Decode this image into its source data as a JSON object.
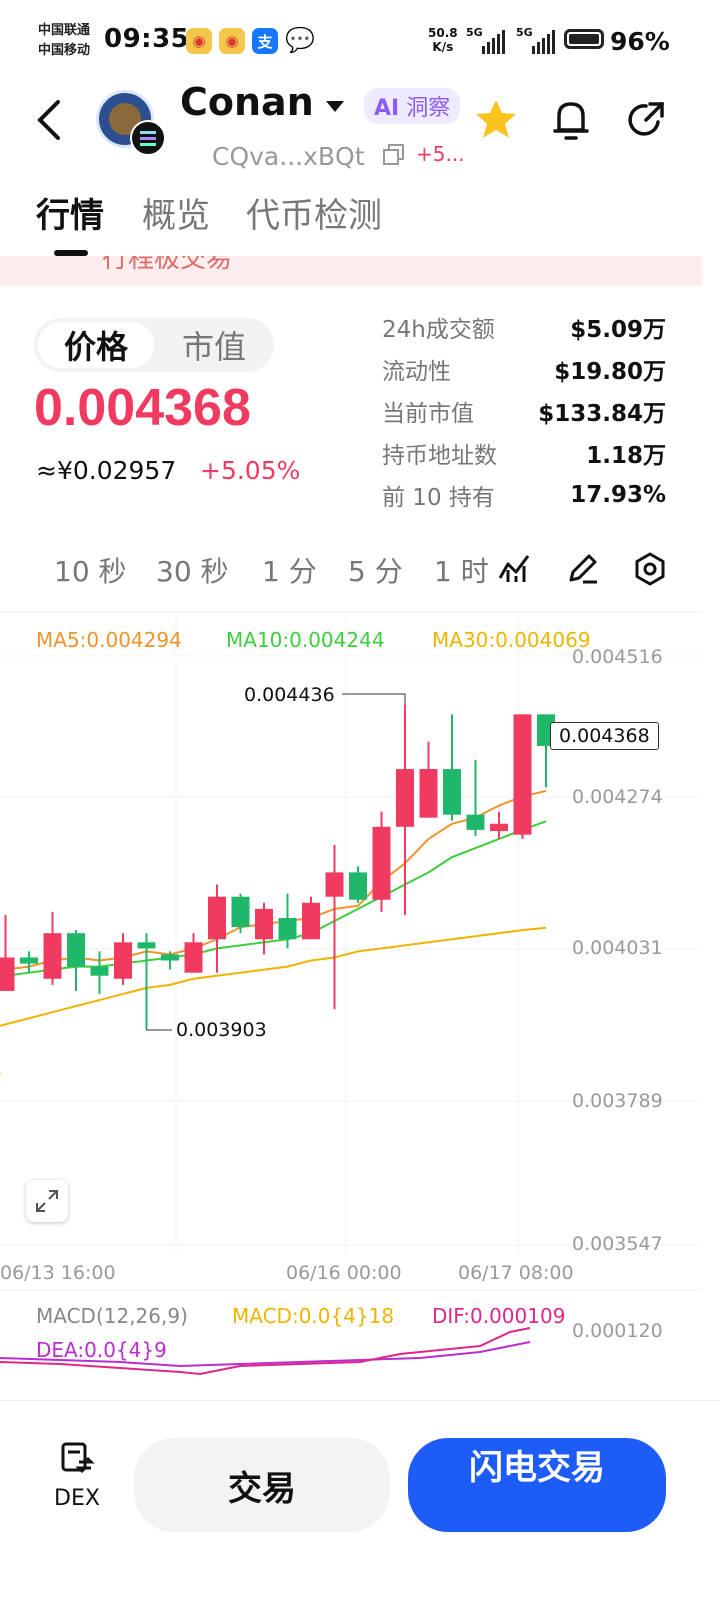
{
  "status_bar": {
    "carrier_1": "中国联通",
    "carrier_2": "中国移动",
    "time": "09:35",
    "net_speed_value": "50.8",
    "net_speed_unit": "K/s",
    "net_type_1": "5G",
    "net_type_2": "5G",
    "battery": "96%",
    "app_icons": [
      "weibo-icon",
      "weibo-icon",
      "alipay-icon",
      "wechat-icon"
    ]
  },
  "header": {
    "title": "Conan",
    "ai_badge_prefix": "AI",
    "ai_badge_label": "洞察",
    "address": "CQva...xBQt",
    "address_change": "+5..."
  },
  "tabs": [
    "行情",
    "概览",
    "代币检测"
  ],
  "banner_text": "行程极交易",
  "toggle": {
    "price": "价格",
    "market_cap": "市值"
  },
  "price": {
    "value": "0.004368",
    "cny": "≈¥0.02957",
    "change": "+5.05%"
  },
  "stats": [
    {
      "label": "24h成交额",
      "value": "$5.09万"
    },
    {
      "label": "流动性",
      "value": "$19.80万"
    },
    {
      "label": "当前市值",
      "value": "$133.84万"
    },
    {
      "label": "持币地址数",
      "value": "1.18万"
    },
    {
      "label": "前 10 持有",
      "value": "17.93%"
    }
  ],
  "timeframes": [
    "10 秒",
    "30 秒",
    "1 分",
    "5 分",
    "1 时"
  ],
  "colors": {
    "up": "#f03a5f",
    "down": "#1fb86a",
    "ma5": "#f0932b",
    "ma10": "#3ccf3c",
    "ma30": "#f0b400",
    "accent": "#1e5cf7",
    "dif": "#e0268a",
    "dea": "#b82ecf"
  },
  "chart": {
    "ma5_label": "MA5:0.004294",
    "ma10_label": "MA10:0.004244",
    "ma30_label": "MA30:0.004069",
    "y_ticks": [
      "0.004516",
      "0.004274",
      "0.004031",
      "0.003789",
      "0.003547"
    ],
    "x_ticks": [
      "06/13 16:00",
      "06/16 00:00",
      "06/17 08:00"
    ],
    "high_label": "0.004436",
    "low_label": "0.003903",
    "last_price_label": "0.004368"
  },
  "macd": {
    "title": "MACD(12,26,9)",
    "macd_label": "MACD:0.0{4}18",
    "dif_label": "DIF:0.000109",
    "dea_label": "DEA:0.0{4}9",
    "y_tick": "0.000120"
  },
  "bottom": {
    "dex_label": "DEX",
    "trade_label": "交易",
    "flash_label": "闪电交易"
  },
  "chart_data": {
    "type": "candlestick",
    "ylim": [
      0.003547,
      0.004516
    ],
    "candles": [
      {
        "open": 0.004,
        "close": 0.00399,
        "high": 0.00401,
        "low": 0.003985
      },
      {
        "open": 0.003965,
        "close": 0.00402,
        "high": 0.00409,
        "low": 0.003965
      },
      {
        "open": 0.00402,
        "close": 0.00401,
        "high": 0.00403,
        "low": 0.003995
      },
      {
        "open": 0.003985,
        "close": 0.00406,
        "high": 0.004095,
        "low": 0.003975
      },
      {
        "open": 0.00406,
        "close": 0.004005,
        "high": 0.004065,
        "low": 0.003965
      },
      {
        "open": 0.004005,
        "close": 0.00399,
        "high": 0.00403,
        "low": 0.00396
      },
      {
        "open": 0.003985,
        "close": 0.004045,
        "high": 0.00406,
        "low": 0.003975
      },
      {
        "open": 0.004045,
        "close": 0.004035,
        "high": 0.00406,
        "low": 0.003903
      },
      {
        "open": 0.004025,
        "close": 0.004015,
        "high": 0.00403,
        "low": 0.004
      },
      {
        "open": 0.003995,
        "close": 0.004045,
        "high": 0.00406,
        "low": 0.003995
      },
      {
        "open": 0.00405,
        "close": 0.00412,
        "high": 0.00414,
        "low": 0.003995
      },
      {
        "open": 0.00412,
        "close": 0.00407,
        "high": 0.004125,
        "low": 0.00406
      },
      {
        "open": 0.00405,
        "close": 0.0041,
        "high": 0.00411,
        "low": 0.004025
      },
      {
        "open": 0.004085,
        "close": 0.00405,
        "high": 0.004125,
        "low": 0.004035
      },
      {
        "open": 0.00405,
        "close": 0.00411,
        "high": 0.00412,
        "low": 0.00405
      },
      {
        "open": 0.00412,
        "close": 0.00416,
        "high": 0.004205,
        "low": 0.003935
      },
      {
        "open": 0.00416,
        "close": 0.004115,
        "high": 0.00417,
        "low": 0.00411
      },
      {
        "open": 0.004115,
        "close": 0.004235,
        "high": 0.00426,
        "low": 0.004095
      },
      {
        "open": 0.004235,
        "close": 0.00433,
        "high": 0.004436,
        "low": 0.00409
      },
      {
        "open": 0.00425,
        "close": 0.00433,
        "high": 0.004375,
        "low": 0.00425
      },
      {
        "open": 0.00433,
        "close": 0.004255,
        "high": 0.00442,
        "low": 0.004245
      },
      {
        "open": 0.004255,
        "close": 0.00423,
        "high": 0.004345,
        "low": 0.00422
      },
      {
        "open": 0.004228,
        "close": 0.00424,
        "high": 0.00426,
        "low": 0.004215
      },
      {
        "open": 0.004222,
        "close": 0.00442,
        "high": 0.00442,
        "low": 0.004215
      },
      {
        "open": 0.00442,
        "close": 0.004368,
        "high": 0.00442,
        "low": 0.0043
      }
    ],
    "ma5": [
      0.003995,
      0.004,
      0.004005,
      0.004015,
      0.00402,
      0.004015,
      0.00402,
      0.00403,
      0.004025,
      0.004035,
      0.00405,
      0.00407,
      0.004075,
      0.00408,
      0.004085,
      0.0041,
      0.004105,
      0.004145,
      0.004175,
      0.004215,
      0.00424,
      0.00425,
      0.00427,
      0.004285,
      0.004294
    ],
    "ma10": [
      0.003985,
      0.00399,
      0.003995,
      0.004,
      0.004005,
      0.004005,
      0.00401,
      0.004015,
      0.00402,
      0.004025,
      0.004035,
      0.00404,
      0.004045,
      0.00405,
      0.00406,
      0.00408,
      0.0041,
      0.00412,
      0.00414,
      0.00416,
      0.004185,
      0.0042,
      0.004215,
      0.00423,
      0.004244
    ],
    "ma30": [
      0.0039,
      0.00391,
      0.00392,
      0.00393,
      0.00394,
      0.00395,
      0.00396,
      0.00397,
      0.003975,
      0.003985,
      0.00399,
      0.003995,
      0.004,
      0.004005,
      0.004015,
      0.00402,
      0.00403,
      0.004035,
      0.00404,
      0.004045,
      0.00405,
      0.004055,
      0.00406,
      0.004065,
      0.004069
    ]
  }
}
